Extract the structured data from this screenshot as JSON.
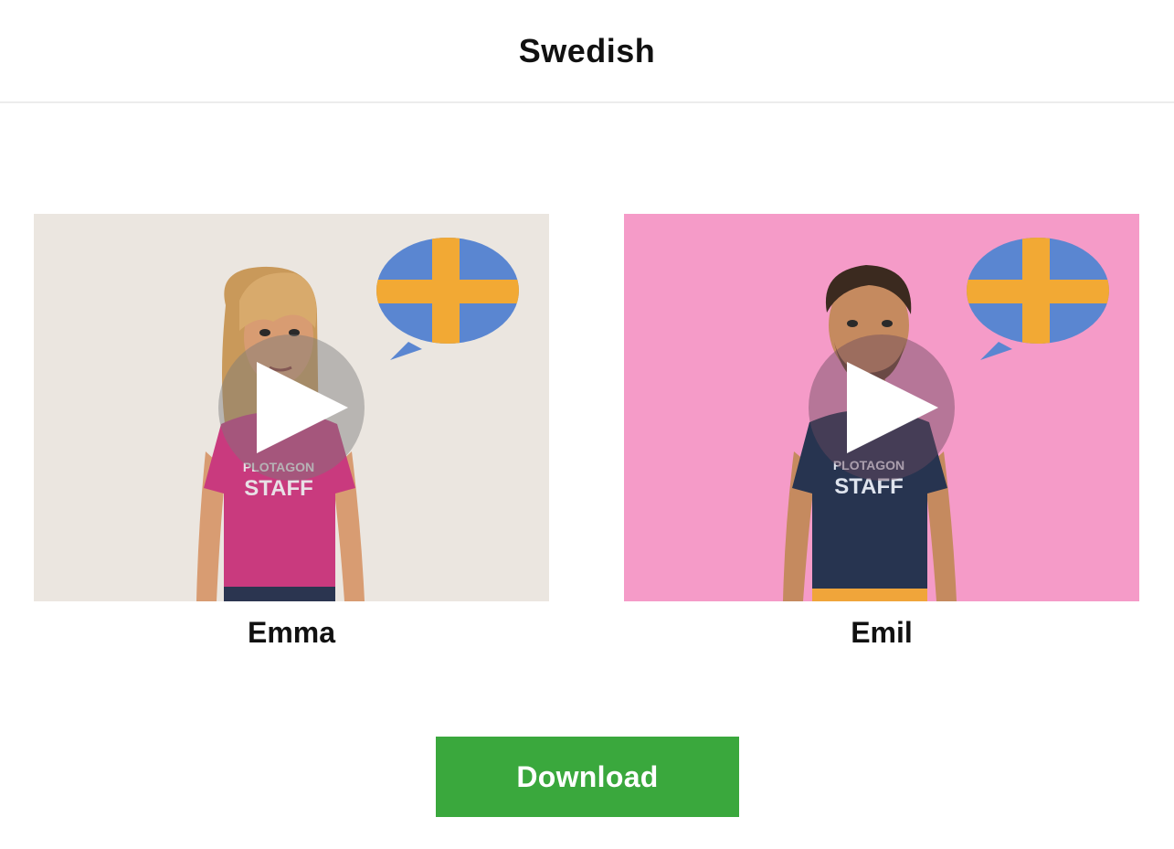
{
  "page": {
    "title": "Swedish"
  },
  "voices": [
    {
      "name": "Emma",
      "background_color": "#ebe6e0",
      "shirt_color": "#c93a7e",
      "shirt_text_line1": "PLOTAGON",
      "shirt_text_line2": "STAFF",
      "flag": "swedish-flag-speech-bubble"
    },
    {
      "name": "Emil",
      "background_color": "#f59bc8",
      "shirt_color": "#273450",
      "shirt_text_line1": "PLOTAGON",
      "shirt_text_line2": "STAFF",
      "flag": "swedish-flag-speech-bubble"
    }
  ],
  "actions": {
    "download_label": "Download"
  },
  "colors": {
    "download_button": "#3aa83d",
    "flag_blue": "#5a86d1",
    "flag_yellow": "#f2a934"
  }
}
